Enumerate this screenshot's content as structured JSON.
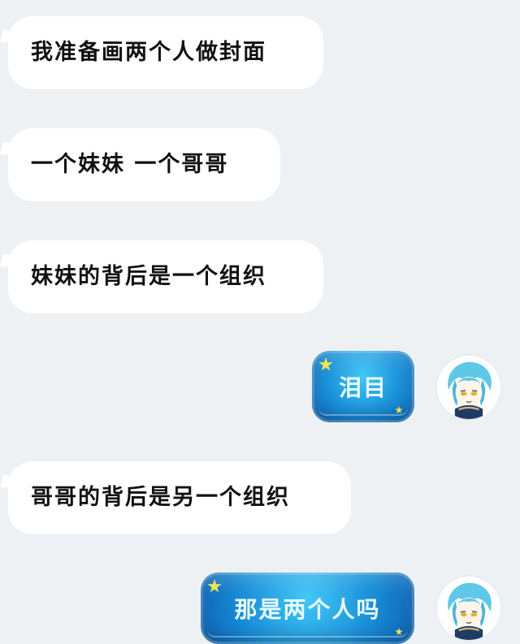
{
  "messages": [
    {
      "side": "left",
      "text": "我准备画两个人做封面"
    },
    {
      "side": "left",
      "text": "一个妹妹 一个哥哥"
    },
    {
      "side": "left",
      "text": "妹妹的背后是一个组织"
    },
    {
      "side": "right",
      "text": "泪目"
    },
    {
      "side": "left",
      "text": "哥哥的背后是另一个组织"
    },
    {
      "side": "right",
      "text": "那是两个人吗"
    }
  ],
  "avatar": {
    "icon": "anime-avatar-icon",
    "hair_color": "#5ec8e6",
    "scarf_color": "#1d3b63"
  },
  "colors": {
    "background": "#eef1f4",
    "left_bubble": "#ffffff",
    "right_bubble_primary": "#1a8fd8",
    "right_bubble_accent": "#43c8f6"
  }
}
